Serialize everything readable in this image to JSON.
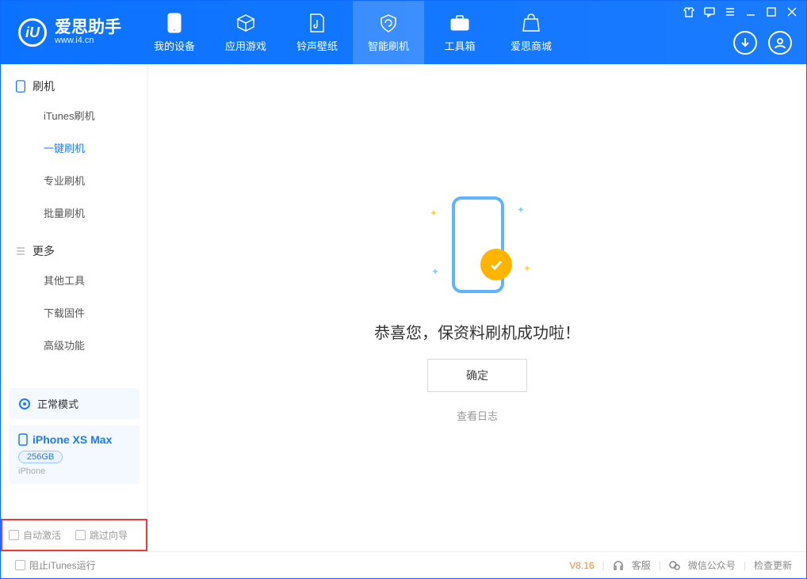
{
  "app": {
    "title": "爱思助手",
    "subtitle": "www.i4.cn"
  },
  "nav": {
    "items": [
      {
        "label": "我的设备"
      },
      {
        "label": "应用游戏"
      },
      {
        "label": "铃声壁纸"
      },
      {
        "label": "智能刷机"
      },
      {
        "label": "工具箱"
      },
      {
        "label": "爱思商城"
      }
    ]
  },
  "sidebar": {
    "group1_title": "刷机",
    "group1_items": [
      "iTunes刷机",
      "一键刷机",
      "专业刷机",
      "批量刷机"
    ],
    "group2_title": "更多",
    "group2_items": [
      "其他工具",
      "下载固件",
      "高级功能"
    ],
    "mode_label": "正常模式",
    "device": {
      "name": "iPhone XS Max",
      "capacity": "256GB",
      "type": "iPhone"
    },
    "options": {
      "auto_activate": "自动激活",
      "skip_guide": "跳过向导"
    }
  },
  "content": {
    "success": "恭喜您，保资料刷机成功啦！",
    "ok": "确定",
    "view_log": "查看日志"
  },
  "bottom": {
    "block_itunes": "阻止iTunes运行",
    "version": "V8.16",
    "support": "客服",
    "wechat": "微信公众号",
    "check_update": "检查更新"
  }
}
